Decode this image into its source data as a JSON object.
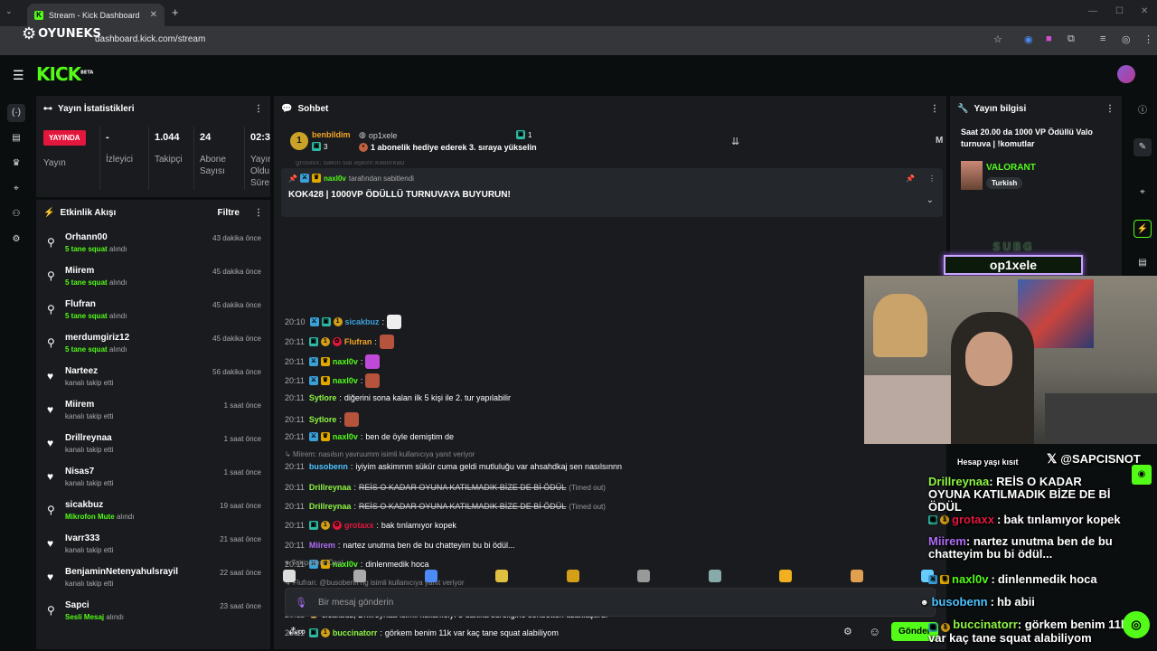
{
  "browser": {
    "tab_title": "Stream - Kick Dashboard",
    "url": "dashboard.kick.com/stream",
    "watermark": "OYUNEKS"
  },
  "kick": {
    "logo": "KICK",
    "beta": "BETA"
  },
  "stats": {
    "title": "Yayın İstatistikleri",
    "live_badge": "YAYINDA",
    "items": [
      {
        "value": "",
        "label": "Yayın"
      },
      {
        "value": "-",
        "label": "İzleyici"
      },
      {
        "value": "1.044",
        "label": "Takipçi"
      },
      {
        "value": "24",
        "label": "Abone Sayısı"
      },
      {
        "value": "02:3",
        "label": "Yayın Oldu Süre"
      }
    ]
  },
  "activity": {
    "title": "Etkinlik Akışı",
    "filter": "Filtre",
    "items": [
      {
        "name": "Orhann00",
        "pre": "",
        "g": "5 tane squat",
        "post": " alındı",
        "time": "43 dakika önce",
        "icon": "gift"
      },
      {
        "name": "Miirem",
        "pre": "",
        "g": "5 tane squat",
        "post": " alındı",
        "time": "45 dakika önce",
        "icon": "gift"
      },
      {
        "name": "Flufran",
        "pre": "",
        "g": "5 tane squat",
        "post": " alındı",
        "time": "45 dakika önce",
        "icon": "gift"
      },
      {
        "name": "merdumgiriz12",
        "pre": "",
        "g": "5 tane squat",
        "post": " alındı",
        "time": "45 dakika önce",
        "icon": "gift"
      },
      {
        "name": "Narteez",
        "pre": "kanalı takip etti",
        "g": "",
        "post": "",
        "time": "56 dakika önce",
        "icon": "heart"
      },
      {
        "name": "Miirem",
        "pre": "kanalı takip etti",
        "g": "",
        "post": "",
        "time": "1 saat önce",
        "icon": "heart"
      },
      {
        "name": "Drillreynaa",
        "pre": "kanalı takip etti",
        "g": "",
        "post": "",
        "time": "1 saat önce",
        "icon": "heart"
      },
      {
        "name": "Nisas7",
        "pre": "kanalı takip etti",
        "g": "",
        "post": "",
        "time": "1 saat önce",
        "icon": "heart"
      },
      {
        "name": "sicakbuz",
        "pre": "",
        "g": "Mikrofon Mute",
        "post": " alındı",
        "time": "19 saat önce",
        "icon": "gift"
      },
      {
        "name": "Ivarr333",
        "pre": "kanalı takip etti",
        "g": "",
        "post": "",
        "time": "21 saat önce",
        "icon": "heart"
      },
      {
        "name": "BenjaminNetenyahulsrayil",
        "pre": "kanalı takip etti",
        "g": "",
        "post": "",
        "time": "22 saat önce",
        "icon": "heart"
      },
      {
        "name": "Sapci",
        "pre": "",
        "g": "Sesli Mesaj",
        "post": " alındı",
        "time": "23 saat önce",
        "icon": "gift"
      }
    ]
  },
  "chat": {
    "title": "Sohbet",
    "hype": {
      "rank": "1",
      "user": "benbildim",
      "count": "3",
      "gifter": "op1xele",
      "gift_count": "1",
      "text": "1 abonelik hediye ederek 3. sıraya yükselin",
      "mod_letter": "M",
      "overflow": "grotaxx: sakın sal aşkım kaldırkad"
    },
    "pinned": {
      "by_user": "naxl0v",
      "by_text": "tarafından sabitlendi",
      "text": "KOK428 | 1000VP ÖDÜLLÜ TURNUVAYA BUYURUN!"
    },
    "messages": [
      {
        "time": "20:10",
        "user": "sicakbuz",
        "text": ""
      },
      {
        "time": "20:11",
        "user": "Flufran",
        "text": ""
      },
      {
        "time": "20:11",
        "user": "naxl0v",
        "text": ""
      },
      {
        "time": "20:11",
        "user": "naxl0v",
        "text": ""
      },
      {
        "time": "20:11",
        "user": "Sytlore",
        "text": "diğerini sona kalan ilk 5 kişi ile 2. tur yapılabilir"
      },
      {
        "time": "20:11",
        "user": "Sytlore",
        "text": ""
      },
      {
        "time": "20:11",
        "user": "naxl0v",
        "text": "ben de öyle demiştim de"
      },
      {
        "reply": "Miirem: nasılsın yavruumm isimli kullanıcıya yanıt veriyor"
      },
      {
        "time": "20:11",
        "user": "busobenn",
        "text": "iyiyim askimmm sükür cuma geldi mutluluğu var ahsahdkaj sen nasılsınnn"
      },
      {
        "time": "20:11",
        "user": "Drillreynaa",
        "text": "REİS O KADAR OYUNA KATILMADIK BİZE DE Bİ ÖDÜL",
        "tag": "(Timed out)"
      },
      {
        "time": "20:11",
        "user": "Drillreynaa",
        "text": "REİS O KADAR OYUNA KATILMADIK BİZE DE Bİ ÖDÜL",
        "tag": "(Timed out)"
      },
      {
        "time": "20:11",
        "user": "grotaxx",
        "text": "bak tınlamıyor kopek"
      },
      {
        "time": "20:11",
        "user": "Miirem",
        "text": "nartez unutma ben de bu chatteyim bu bi ödül..."
      },
      {
        "time": "20:11",
        "user": "naxl0v",
        "text": "dinlenmedik hoca"
      },
      {
        "reply": "Flufran: @busobenn hg isimli kullanıcıya yanıt veriyor"
      },
      {
        "time": "20:11",
        "user": "busobenn",
        "text": "hb abii"
      },
      {
        "time": "20:11",
        "user": "sicakbuz, Drillreynaa",
        "text": "isimli kullanıcıyı 5 dakika süreliğine sohbetten uzaklaştırdı"
      },
      {
        "time": "20:11",
        "user": "buccinatorr",
        "text": "görkem benim 11k var kaç tane squat alabiliyom"
      }
    ],
    "followers_only": "Takipçilere Özel",
    "input_placeholder": "Bir mesaj gönderin",
    "send": "Gönder"
  },
  "stream_info": {
    "title": "Yayın bilgisi",
    "stream_title": "Saat 20.00 da 1000 VP Ödüllü Valo turnuva | !komutlar",
    "category": "VALORANT",
    "tag": "Turkish"
  },
  "overlay": {
    "subg_label": "SUBG",
    "subg_user": "op1xele",
    "social": "@SAPCISNOT",
    "age_note": "Hesap yaşı kısıt",
    "chat": [
      {
        "user": "Drillreynaa",
        "text": "REİS O KADAR OYUNA KATILMADIK BİZE DE Bİ ÖDÜL"
      },
      {
        "user": "grotaxx",
        "text": "bak tınlamıyor kopek"
      },
      {
        "user": "Miirem",
        "text": "nartez unutma ben de bu chatteyim bu bi ödül..."
      },
      {
        "user": "naxl0v",
        "text": "dinlenmedik hoca"
      },
      {
        "user": "busobenn",
        "text": "hb abii"
      },
      {
        "user": "buccinatorr",
        "text": "görkem benim 11k var kaç tane squat alabiliyom"
      }
    ]
  }
}
